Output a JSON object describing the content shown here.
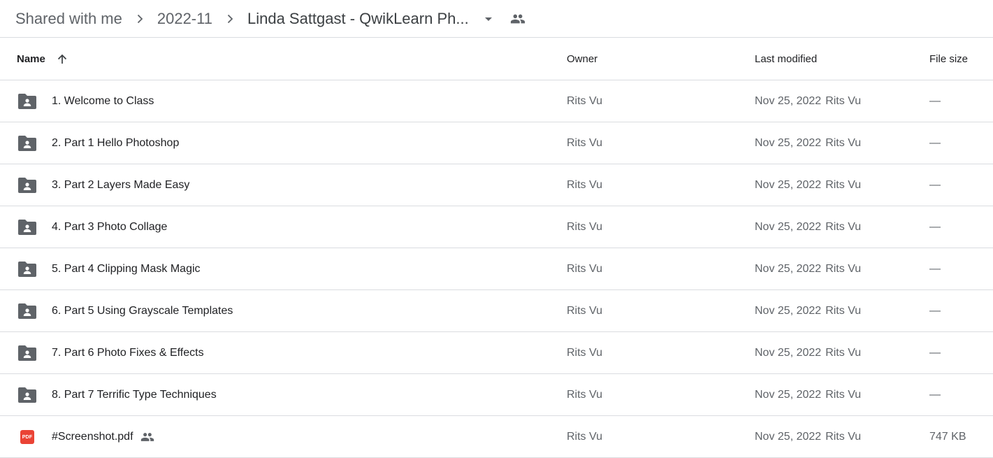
{
  "breadcrumb": {
    "items": [
      "Shared with me",
      "2022-11",
      "Linda Sattgast - QwikLearn Ph..."
    ]
  },
  "icons": {
    "separator": "chevron-right-icon",
    "dropdown": "arrow-drop-down-icon",
    "shared": "people-icon",
    "folder": "shared-folder-icon",
    "pdf": "pdf-icon",
    "sort": "arrow-up-icon"
  },
  "table": {
    "headers": {
      "name": "Name",
      "owner": "Owner",
      "modified": "Last modified",
      "size": "File size"
    },
    "rows": [
      {
        "name": "1. Welcome to Class",
        "owner": "Rits Vu",
        "modified": "Nov 25, 2022",
        "modified_by": "Rits Vu",
        "size": "—"
      },
      {
        "name": "2. Part 1 Hello Photoshop",
        "owner": "Rits Vu",
        "modified": "Nov 25, 2022",
        "modified_by": "Rits Vu",
        "size": "—"
      },
      {
        "name": "3. Part 2 Layers Made Easy",
        "owner": "Rits Vu",
        "modified": "Nov 25, 2022",
        "modified_by": "Rits Vu",
        "size": "—"
      },
      {
        "name": "4. Part 3 Photo Collage",
        "owner": "Rits Vu",
        "modified": "Nov 25, 2022",
        "modified_by": "Rits Vu",
        "size": "—"
      },
      {
        "name": "5. Part 4 Clipping Mask Magic",
        "owner": "Rits Vu",
        "modified": "Nov 25, 2022",
        "modified_by": "Rits Vu",
        "size": "—"
      },
      {
        "name": "6. Part 5 Using Grayscale Templates",
        "owner": "Rits Vu",
        "modified": "Nov 25, 2022",
        "modified_by": "Rits Vu",
        "size": "—"
      },
      {
        "name": "7. Part 6 Photo Fixes & Effects",
        "owner": "Rits Vu",
        "modified": "Nov 25, 2022",
        "modified_by": "Rits Vu",
        "size": "—"
      },
      {
        "name": "8. Part 7 Terrific Type Techniques",
        "owner": "Rits Vu",
        "modified": "Nov 25, 2022",
        "modified_by": "Rits Vu",
        "size": "—"
      },
      {
        "name": "#Screenshot.pdf",
        "owner": "Rits Vu",
        "modified": "Nov 25, 2022",
        "modified_by": "Rits Vu",
        "size": "747 KB",
        "pdf_label": "PDF"
      }
    ]
  },
  "colors": {
    "folder": "#5f6368",
    "pdf": "#ea4335",
    "divider": "#dadce0"
  }
}
